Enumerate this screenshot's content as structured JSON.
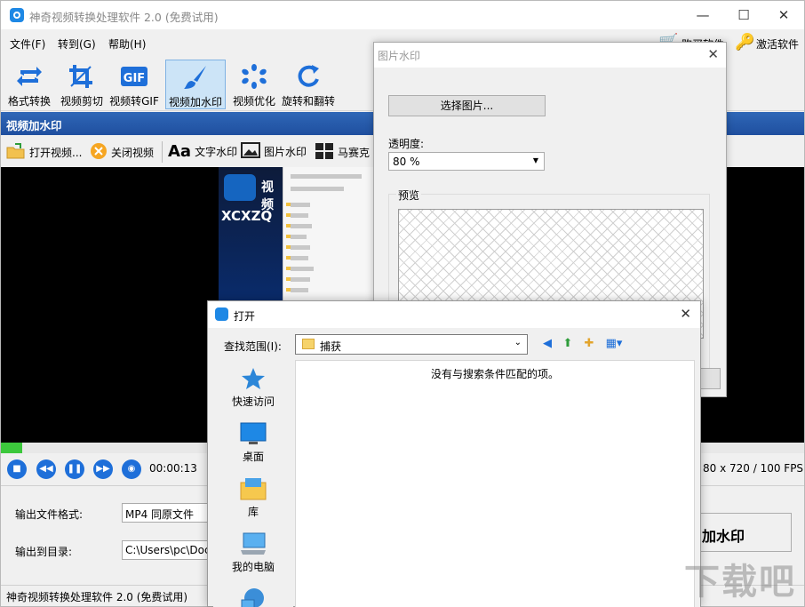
{
  "app": {
    "title": "神奇视频转换处理软件 2.0 (免费试用)",
    "window_controls": {
      "minimize": "—",
      "maximize": "☐",
      "close": "✕"
    }
  },
  "menu": {
    "file": "文件(F)",
    "goto": "转到(G)",
    "help": "帮助(H)",
    "buy": "购买软件",
    "activate": "激活软件"
  },
  "toolbar": {
    "items": [
      {
        "label": "格式转换",
        "icon": "convert-icon"
      },
      {
        "label": "视频剪切",
        "icon": "crop-icon"
      },
      {
        "label": "视频转GIF",
        "icon": "gif-icon"
      },
      {
        "label": "视频加水印",
        "icon": "brush-icon",
        "active": true
      },
      {
        "label": "视频优化",
        "icon": "optimize-icon"
      },
      {
        "label": "旋转和翻转",
        "icon": "rotate-icon"
      }
    ]
  },
  "section_title": "视频加水印",
  "subtoolbar": {
    "open_video": "打开视频...",
    "close_video": "关闭视频",
    "text_watermark": "文字水印",
    "image_watermark": "图片水印",
    "mosaic": "马赛克"
  },
  "preview": {
    "logo_text": "XCXZQ",
    "logo_word": "视频"
  },
  "playback": {
    "time": "00:00:13",
    "resolution_fps": "80 x 720 / 100 FPS",
    "progress_fraction": 0.027
  },
  "output": {
    "format_label": "输出文件格式:",
    "format_value": "MP4 同原文件",
    "dir_label": "输出到目录:",
    "dir_value": "C:\\Users\\pc\\Docu",
    "start_button": "加水印"
  },
  "statusbar": "神奇视频转换处理软件 2.0 (免费试用)",
  "watermark_dialog": {
    "title": "图片水印",
    "close": "✕",
    "choose_image": "选择图片...",
    "opacity_label": "透明度:",
    "opacity_value": "80 %",
    "preview_label": "预览"
  },
  "open_dialog": {
    "title": "打开",
    "close": "✕",
    "lookin_label": "查找范围(I):",
    "lookin_value": "捕获",
    "empty_message": "没有与搜索条件匹配的项。",
    "places": [
      {
        "label": "快速访问",
        "icon": "star-icon"
      },
      {
        "label": "桌面",
        "icon": "desktop-icon"
      },
      {
        "label": "库",
        "icon": "library-icon"
      },
      {
        "label": "我的电脑",
        "icon": "computer-icon"
      },
      {
        "label": "",
        "icon": "network-icon"
      }
    ]
  },
  "site_watermark": "下载吧"
}
